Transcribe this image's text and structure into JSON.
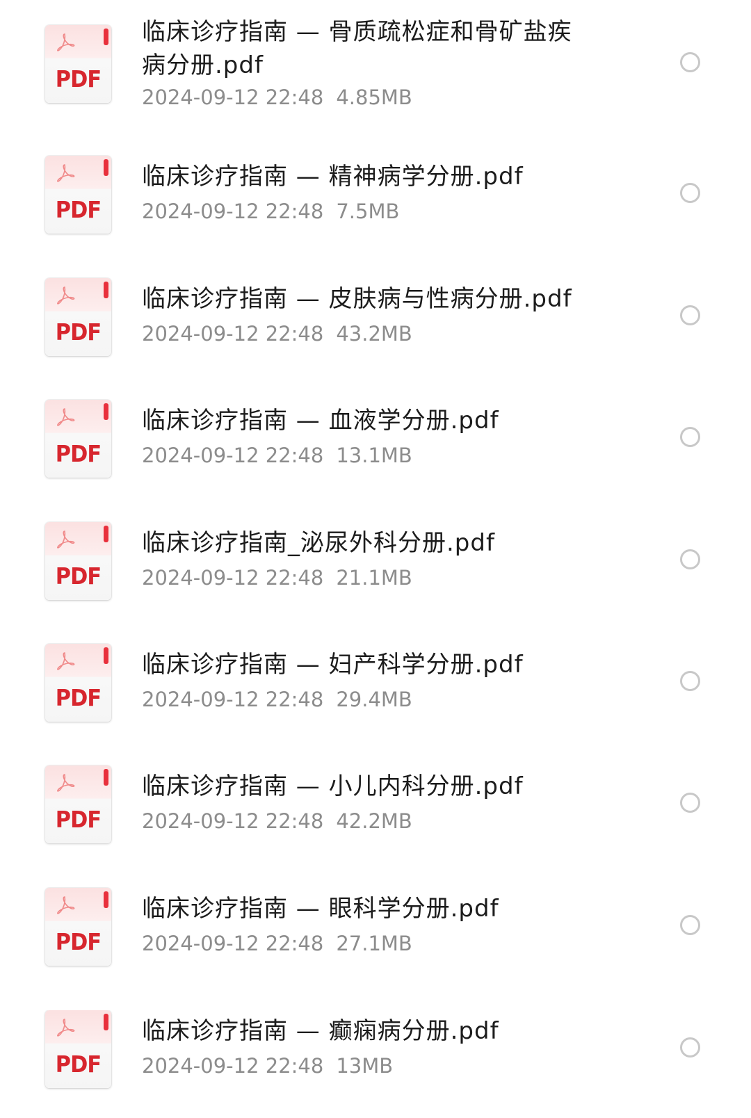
{
  "files": [
    {
      "name": "临床诊疗指南 — 骨质疏松症和骨矿盐疾病分册.pdf",
      "date": "2024-09-12 22:48",
      "size": "4.85MB",
      "icon": "pdf-file-icon",
      "icon_label": "PDF",
      "selected": false
    },
    {
      "name": "临床诊疗指南 — 精神病学分册.pdf",
      "date": "2024-09-12 22:48",
      "size": "7.5MB",
      "icon": "pdf-file-icon",
      "icon_label": "PDF",
      "selected": false
    },
    {
      "name": "临床诊疗指南 — 皮肤病与性病分册.pdf",
      "date": "2024-09-12 22:48",
      "size": "43.2MB",
      "icon": "pdf-file-icon",
      "icon_label": "PDF",
      "selected": false
    },
    {
      "name": "临床诊疗指南 — 血液学分册.pdf",
      "date": "2024-09-12 22:48",
      "size": "13.1MB",
      "icon": "pdf-file-icon",
      "icon_label": "PDF",
      "selected": false
    },
    {
      "name": "临床诊疗指南_泌尿外科分册.pdf",
      "date": "2024-09-12 22:48",
      "size": "21.1MB",
      "icon": "pdf-file-icon",
      "icon_label": "PDF",
      "selected": false
    },
    {
      "name": "临床诊疗指南 — 妇产科学分册.pdf",
      "date": "2024-09-12 22:48",
      "size": "29.4MB",
      "icon": "pdf-file-icon",
      "icon_label": "PDF",
      "selected": false
    },
    {
      "name": "临床诊疗指南 — 小儿内科分册.pdf",
      "date": "2024-09-12 22:48",
      "size": "42.2MB",
      "icon": "pdf-file-icon",
      "icon_label": "PDF",
      "selected": false
    },
    {
      "name": "临床诊疗指南 — 眼科学分册.pdf",
      "date": "2024-09-12 22:48",
      "size": "27.1MB",
      "icon": "pdf-file-icon",
      "icon_label": "PDF",
      "selected": false
    },
    {
      "name": "临床诊疗指南 — 癫痫病分册.pdf",
      "date": "2024-09-12 22:48",
      "size": "13MB",
      "icon": "pdf-file-icon",
      "icon_label": "PDF",
      "selected": false
    }
  ],
  "colors": {
    "pdf_red": "#d7262e",
    "name_text": "#1c1c1c",
    "meta_text": "#8c8c8c",
    "radio_border": "#c8c8c8"
  }
}
